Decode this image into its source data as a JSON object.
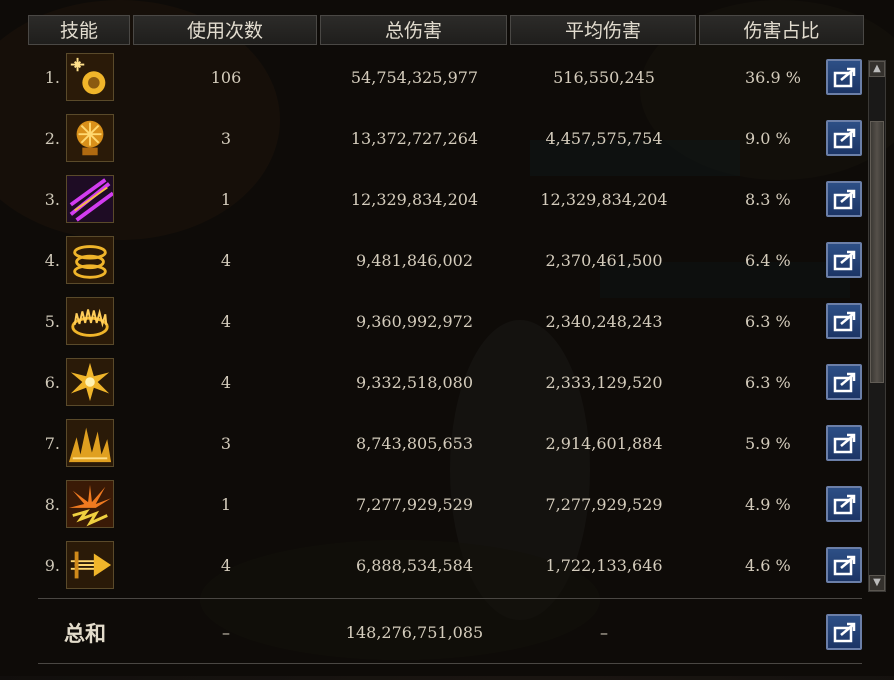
{
  "headers": [
    "技能",
    "使用次数",
    "总伤害",
    "平均伤害",
    "伤害占比"
  ],
  "rows": [
    {
      "rank": "1.",
      "icon": "grenade-skill-icon",
      "uses": "106",
      "total": "54,754,325,977",
      "avg": "516,550,245",
      "pct": "36.9 %"
    },
    {
      "rank": "2.",
      "icon": "explosion-skill-icon",
      "uses": "3",
      "total": "13,372,727,264",
      "avg": "4,457,575,754",
      "pct": "9.0 %"
    },
    {
      "rank": "3.",
      "icon": "purple-slash-skill-icon",
      "uses": "1",
      "total": "12,329,834,204",
      "avg": "12,329,834,204",
      "pct": "8.3 %"
    },
    {
      "rank": "4.",
      "icon": "ring-skill-icon",
      "uses": "4",
      "total": "9,481,846,002",
      "avg": "2,370,461,500",
      "pct": "6.4 %"
    },
    {
      "rank": "5.",
      "icon": "fire-ring-skill-icon",
      "uses": "4",
      "total": "9,360,992,972",
      "avg": "2,340,248,243",
      "pct": "6.3 %"
    },
    {
      "rank": "6.",
      "icon": "burst-skill-icon",
      "uses": "4",
      "total": "9,332,518,080",
      "avg": "2,333,129,520",
      "pct": "6.3 %"
    },
    {
      "rank": "7.",
      "icon": "spike-skill-icon",
      "uses": "3",
      "total": "8,743,805,653",
      "avg": "2,914,601,884",
      "pct": "5.9 %"
    },
    {
      "rank": "8.",
      "icon": "flame-burst-skill-icon",
      "uses": "1",
      "total": "7,277,929,529",
      "avg": "7,277,929,529",
      "pct": "4.9 %"
    },
    {
      "rank": "9.",
      "icon": "dash-skill-icon",
      "uses": "4",
      "total": "6,888,534,584",
      "avg": "1,722,133,646",
      "pct": "4.6 %"
    }
  ],
  "total": {
    "label": "总和",
    "uses": "–",
    "total": "148,276,751,085",
    "avg": "–"
  },
  "colors": {
    "gold": "#f0b52a",
    "share_button": "#1c3566"
  }
}
